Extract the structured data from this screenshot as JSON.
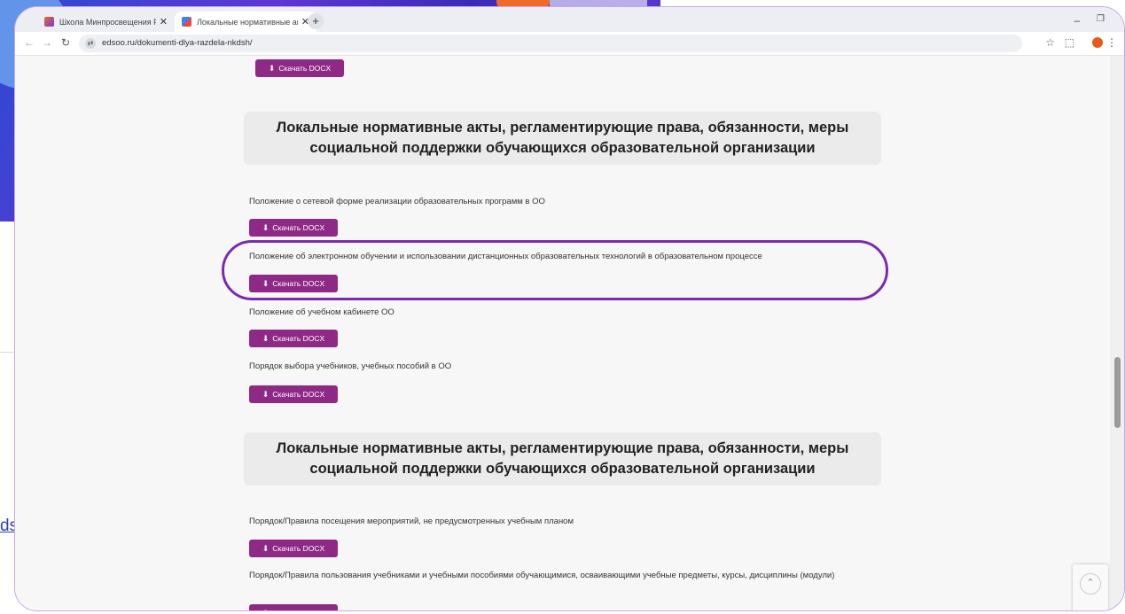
{
  "background": {
    "link_text": "dsh/"
  },
  "browser": {
    "tabs": [
      {
        "label": "Школа Минпросвещения Рос"
      },
      {
        "label": "Локальные нормативные акты"
      }
    ],
    "tab_close_glyph": "✕",
    "new_tab_glyph": "+",
    "url": "edsoo.ru/dokumenti-dlya-razdela-nkdsh/",
    "icons": [
      "back-icon",
      "forward-icon",
      "reload-icon",
      "site-info-icon",
      "star-icon",
      "extensions-icon",
      "profile-icon",
      "menu-icon",
      "minimize-icon",
      "maximize-icon"
    ]
  },
  "download_label": "Скачать DOCX",
  "colors": {
    "button": "#8e2a86",
    "highlight": "#7a2bb0",
    "window_border": "#c9a7e6"
  },
  "sections": [
    {
      "heading": "Локальные нормативные акты, регламентирующие права, обязанности, меры социальной поддержки обучающихся образовательной организации",
      "documents": [
        {
          "title": "Положение о сетевой форме реализации образовательных программ в ОО"
        },
        {
          "title": "Положение об электронном обучении и использовании дистанционных образовательных технологий в образовательном процессе",
          "highlighted": true
        },
        {
          "title": "Положение об учебном кабинете ОО"
        },
        {
          "title": "Порядок выбора учебников, учебных пособий в ОО"
        }
      ]
    },
    {
      "heading": "Локальные нормативные акты, регламентирующие права, обязанности, меры социальной поддержки обучающихся образовательной организации",
      "documents": [
        {
          "title": "Порядок/Правила посещения мероприятий, не предусмотренных учебным планом"
        },
        {
          "title": "Порядок/Правила пользования учебниками и учебными пособиями обучающимися, осваивающими учебные предметы, курсы, дисциплины (модули)"
        }
      ]
    }
  ]
}
